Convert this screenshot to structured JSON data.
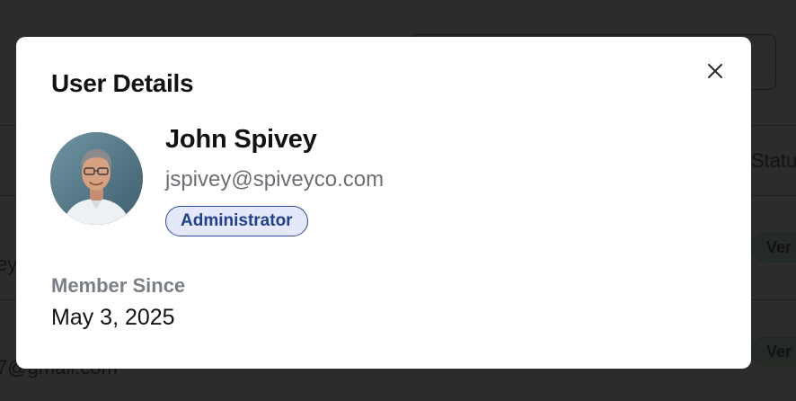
{
  "background": {
    "table_header_status": "Statu",
    "rows": [
      {
        "text_fragment": "ey",
        "badge": "Ver"
      },
      {
        "text_fragment": "7@gmail.com",
        "badge": "Ver"
      }
    ]
  },
  "modal": {
    "title": "User Details",
    "close_icon": "close-icon",
    "user": {
      "name": "John Spivey",
      "email": "jspivey@spiveyco.com",
      "role": "Administrator",
      "avatar": "avatar-photo"
    },
    "member_since": {
      "label": "Member Since",
      "value": "May 3, 2025"
    }
  },
  "colors": {
    "overlay": "#2c2c2c",
    "modal_bg": "#ffffff",
    "text_primary": "#121212",
    "text_secondary": "#6b6f74",
    "badge_bg": "#e3e9fb",
    "badge_border": "#2b4aa0",
    "badge_text": "#23408f"
  }
}
